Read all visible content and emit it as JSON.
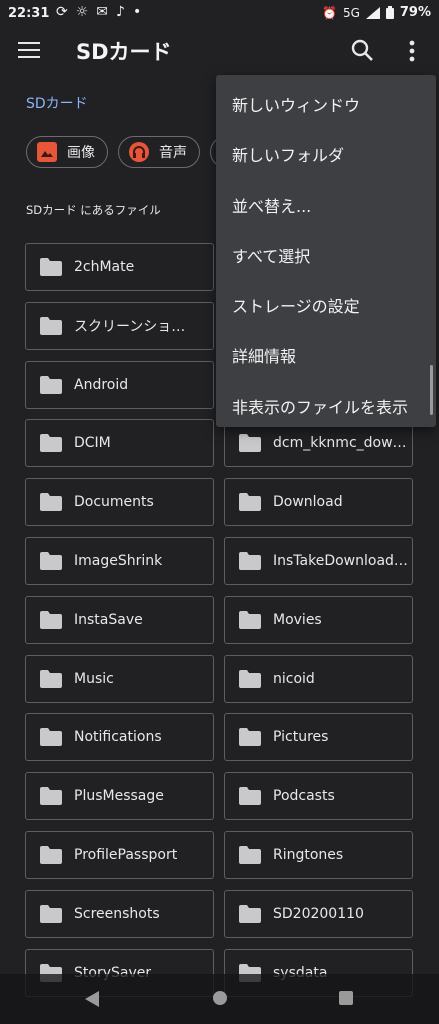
{
  "status": {
    "time": "22:31",
    "network": "5G",
    "battery": "79%"
  },
  "appbar": {
    "title": "SDカード"
  },
  "breadcrumb": "SDカード",
  "chips": [
    {
      "label": "画像",
      "icon": "image-icon",
      "color": "#e8563a"
    },
    {
      "label": "音声",
      "icon": "headphones-icon",
      "color": "#e8563a"
    }
  ],
  "section_title": "SDカード にあるファイル",
  "folders": [
    "2chMate",
    "",
    "スクリーンショ…",
    "",
    "Android",
    "",
    "DCIM",
    "dcm_kknmc_dow…",
    "Documents",
    "Download",
    "ImageShrink",
    "InsTakeDownload…",
    "InstaSave",
    "Movies",
    "Music",
    "nicoid",
    "Notifications",
    "Pictures",
    "PlusMessage",
    "Podcasts",
    "ProfilePassport",
    "Ringtones",
    "Screenshots",
    "SD20200110",
    "StorySaver",
    "sysdata"
  ],
  "menu": [
    "新しいウィンドウ",
    "新しいフォルダ",
    "並べ替え...",
    "すべて選択",
    "ストレージの設定",
    "詳細情報",
    "非表示のファイルを表示"
  ],
  "colors": {
    "background": "#212124",
    "menu": "#3d3f42",
    "accent": "#8ab4f8"
  }
}
